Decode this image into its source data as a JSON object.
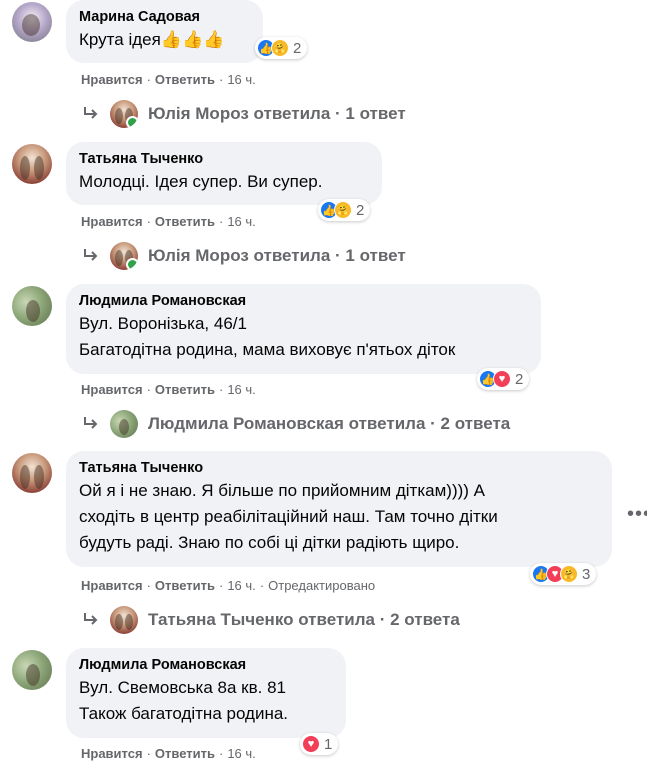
{
  "comments": [
    {
      "author": "Марина Садовая",
      "lines": [
        "Крута ідея👍👍👍"
      ],
      "reaction_count": "2",
      "actions": {
        "like": "Нравится",
        "reply": "Ответить",
        "time": "16 ч."
      },
      "reply_summary": "Юлія Мороз ответила · 1 ответ"
    },
    {
      "author": "Татьяна Тыченко",
      "lines": [
        "Молодці. Ідея супер. Ви супер."
      ],
      "reaction_count": "2",
      "actions": {
        "like": "Нравится",
        "reply": "Ответить",
        "time": "16 ч."
      },
      "reply_summary": "Юлія Мороз ответила · 1 ответ"
    },
    {
      "author": "Людмила Романовская",
      "lines": [
        "Вул. Воронізька, 46/1",
        "Багатодітна родина, мама виховує п'ятьох діток"
      ],
      "reaction_count": "2",
      "actions": {
        "like": "Нравится",
        "reply": "Ответить",
        "time": "16 ч."
      },
      "reply_summary": "Людмила Романовская ответила · 2 ответа"
    },
    {
      "author": "Татьяна Тыченко",
      "lines": [
        "Ой я і не знаю. Я більше по прийомним діткам)))) А",
        "сходіть в центр реабілітаційний наш. Там точно дітки",
        "будуть раді. Знаю по собі ці дітки радіють щиро."
      ],
      "reaction_count": "3",
      "actions": {
        "like": "Нравится",
        "reply": "Ответить",
        "time": "16 ч.",
        "edited": "Отредактировано"
      },
      "reply_summary": "Татьяна Тыченко ответила · 2 ответа"
    },
    {
      "author": "Людмила Романовская",
      "lines": [
        "Вул. Свемовська 8а кв. 81",
        "Також багатодітна родина."
      ],
      "reaction_count": "1",
      "actions": {
        "like": "Нравится",
        "reply": "Ответить",
        "time": "16 ч."
      }
    }
  ],
  "icons": {
    "like": "like-reaction-icon",
    "care": "care-reaction-icon",
    "love": "love-reaction-icon",
    "reply_arrow": "reply-arrow-icon",
    "more": "more-options-icon"
  },
  "colors": {
    "bubble": "#f0f2f5",
    "secondary_text": "#65676b",
    "like": "#1877f2",
    "love": "#f33e58",
    "care": "#f7b928",
    "online": "#31a24c"
  }
}
